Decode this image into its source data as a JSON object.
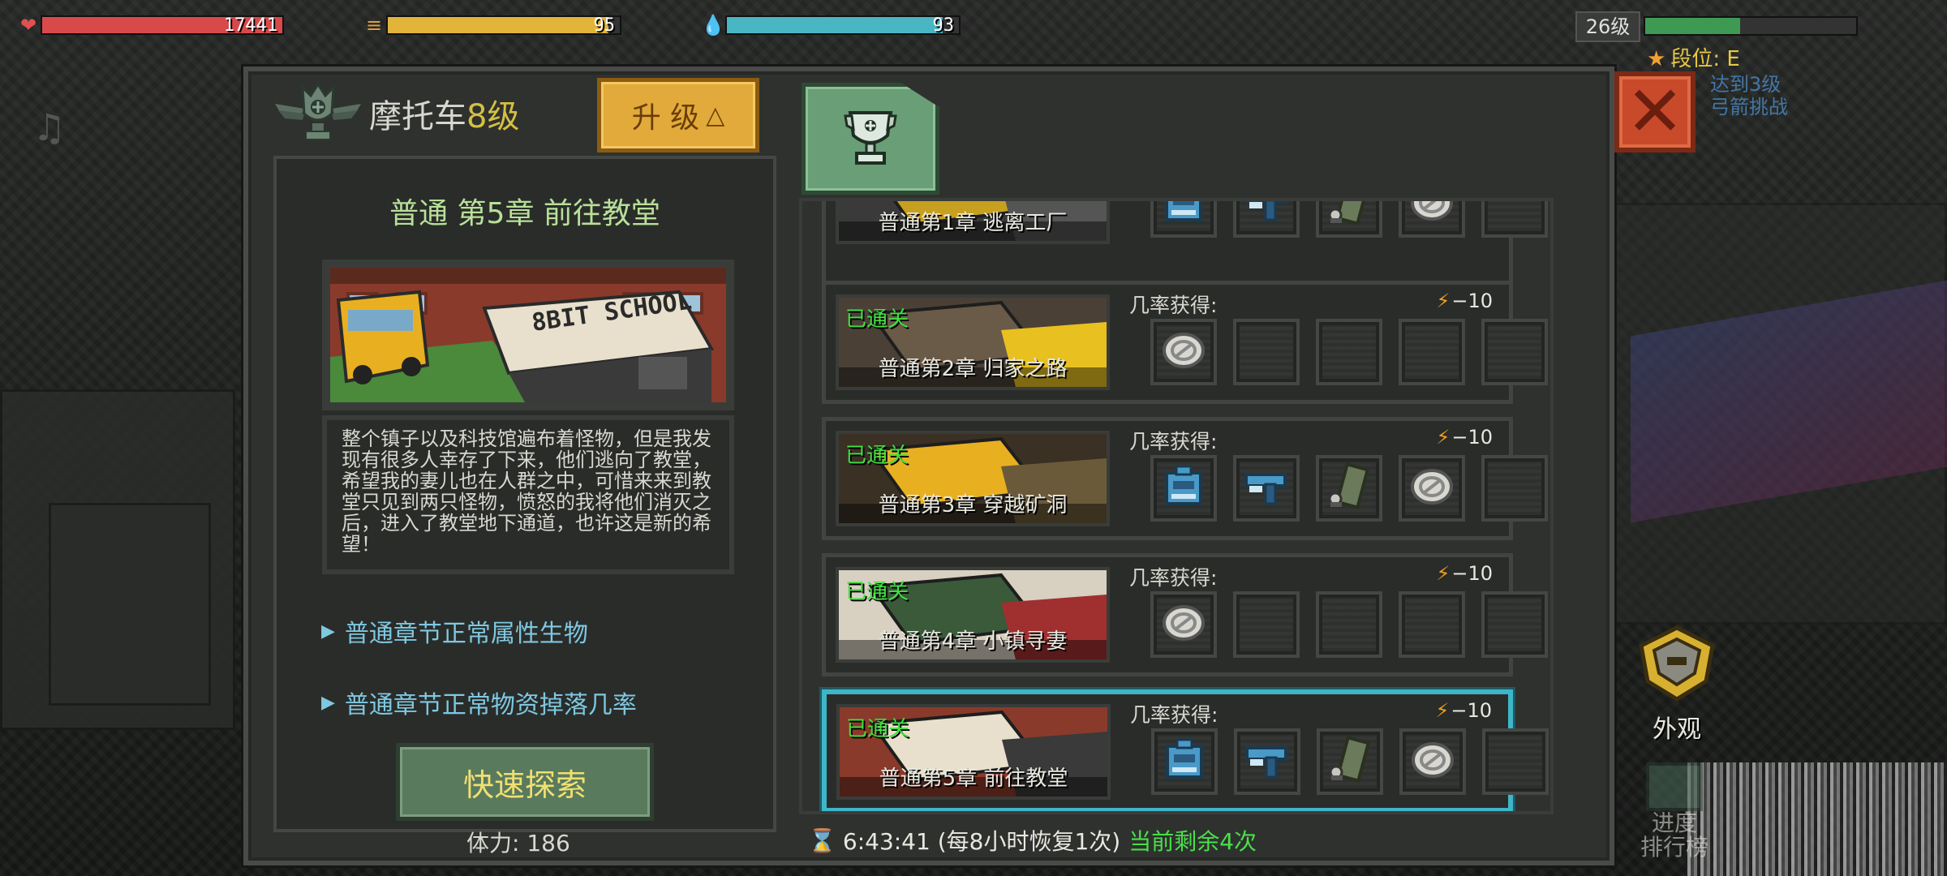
{
  "hud": {
    "hp": {
      "value": "17441",
      "fill": 1.0,
      "color": "#d84a4a"
    },
    "food": {
      "value": "95",
      "fill": 0.95,
      "color": "#e2b43a"
    },
    "water": {
      "value": "93",
      "fill": 0.93,
      "color": "#49b6c4"
    },
    "player_level": "26级",
    "xp_fill": 0.45,
    "rank": "段位: E",
    "task_hint_line1": "达到3级",
    "task_hint_line2": "弓箭挑战"
  },
  "modal": {
    "vehicle_name": "摩托车",
    "vehicle_level": "8级",
    "upgrade_label": "升 级",
    "upgrade_arrow": "△",
    "close_glyph": "✕"
  },
  "detail": {
    "chapter_title": "普通 第5章 前往教堂",
    "image_sign": "8BIT SCHOOL",
    "description": "整个镇子以及科技馆遍布着怪物，但是我发现有很多人幸存了下来，他们逃向了教堂，希望我的妻儿也在人群之中，可惜来来到教堂只见到两只怪物，愤怒的我将他们消灭之后，进入了教堂地下通道，也许这是新的希望！",
    "link_creatures": "普通章节正常属性生物",
    "link_drops": "普通章节正常物资掉落几率",
    "quick_explore": "快速探索",
    "stamina": "体力: 186"
  },
  "chapters": [
    {
      "name": "普通第1章 逃离工厂",
      "cleared": "",
      "drop_label": "",
      "cost": "",
      "slots": [
        "backpack",
        "gun",
        "ammo",
        "coin",
        "empty"
      ],
      "selected": false
    },
    {
      "name": "普通第2章 归家之路",
      "cleared": "已通关",
      "drop_label": "几率获得:",
      "cost": "−10",
      "slots": [
        "coin",
        "empty",
        "empty",
        "empty",
        "empty"
      ],
      "selected": false
    },
    {
      "name": "普通第3章 穿越矿洞",
      "cleared": "已通关",
      "drop_label": "几率获得:",
      "cost": "−10",
      "slots": [
        "backpack",
        "gun",
        "ammo",
        "coin",
        "empty"
      ],
      "selected": false
    },
    {
      "name": "普通第4章 小镇寻妻",
      "cleared": "已通关",
      "drop_label": "几率获得:",
      "cost": "−10",
      "slots": [
        "coin",
        "empty",
        "empty",
        "empty",
        "empty"
      ],
      "selected": false
    },
    {
      "name": "普通第5章 前往教堂",
      "cleared": "已通关",
      "drop_label": "几率获得:",
      "cost": "−10",
      "slots": [
        "backpack",
        "gun",
        "ammo",
        "coin",
        "empty"
      ],
      "selected": true
    }
  ],
  "footer": {
    "timer": "6:43:41 (每8小时恢复1次)",
    "remaining": "当前剩余4次"
  },
  "side": {
    "appearance": "外观",
    "leaderboard_line1": "进度",
    "leaderboard_line2": "排行榜"
  },
  "colors": {
    "accent_green": "#b8e098",
    "cleared_green": "#40e040",
    "selected_border": "#3eb6c8",
    "upgrade_gold": "#e2aa3a",
    "close_red": "#c84a2a"
  }
}
